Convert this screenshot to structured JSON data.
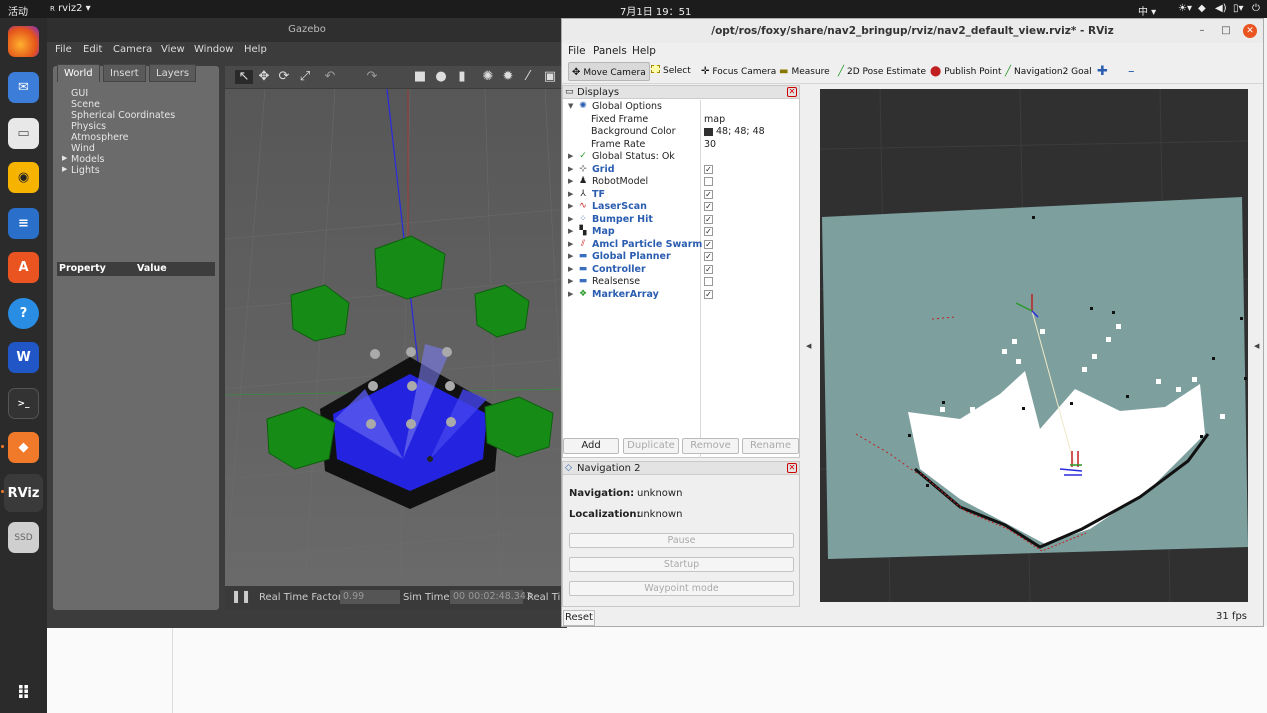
{
  "topbar": {
    "activities": "活动",
    "app": "rviz2",
    "clock": "7月1日  19：51",
    "ime": "中"
  },
  "gazebo": {
    "title": "Gazebo",
    "menu": [
      "File",
      "Edit",
      "Camera",
      "View",
      "Window",
      "Help"
    ],
    "tabs": [
      "World",
      "Insert",
      "Layers"
    ],
    "tree": [
      "GUI",
      "Scene",
      "Spherical Coordinates",
      "Physics",
      "Atmosphere",
      "Wind",
      "Models",
      "Lights"
    ],
    "prop_header": [
      "Property",
      "Value"
    ],
    "status": {
      "rtf_label": "Real Time Factor:",
      "rtf_value": "0.99",
      "sim_label": "Sim Time:",
      "sim_value": "00 00:02:48.343",
      "real_label": "Real Ti"
    }
  },
  "rviz": {
    "title": "/opt/ros/foxy/share/nav2_bringup/rviz/nav2_default_view.rviz* - RViz",
    "menu": [
      "File",
      "Panels",
      "Help"
    ],
    "tools": [
      "Move Camera",
      "Select",
      "Focus Camera",
      "Measure",
      "2D Pose Estimate",
      "Publish Point",
      "Navigation2 Goal"
    ],
    "displays_title": "Displays",
    "global_options": "Global Options",
    "options": [
      {
        "name": "Fixed Frame",
        "value": "map"
      },
      {
        "name": "Background Color",
        "value": "48; 48; 48"
      },
      {
        "name": "Frame Rate",
        "value": "30"
      }
    ],
    "global_status": "Global Status: Ok",
    "displays": [
      {
        "name": "Grid",
        "checked": "✓"
      },
      {
        "name": "RobotModel",
        "checked": ""
      },
      {
        "name": "TF",
        "checked": "✓"
      },
      {
        "name": "LaserScan",
        "checked": "✓"
      },
      {
        "name": "Bumper Hit",
        "checked": "✓"
      },
      {
        "name": "Map",
        "checked": "✓"
      },
      {
        "name": "Amcl Particle Swarm",
        "checked": "✓"
      },
      {
        "name": "Global Planner",
        "checked": "✓"
      },
      {
        "name": "Controller",
        "checked": "✓"
      },
      {
        "name": "Realsense",
        "checked": ""
      },
      {
        "name": "MarkerArray",
        "checked": "✓"
      }
    ],
    "buttons": [
      "Add",
      "Duplicate",
      "Remove",
      "Rename"
    ],
    "nav_title": "Navigation 2",
    "navigation_label": "Navigation:",
    "navigation_value": "unknown",
    "localization_label": "Localization:",
    "localization_value": "unknown",
    "nav_buttons": [
      "Pause",
      "Startup",
      "Waypoint mode"
    ],
    "reset": "Reset",
    "fps": "31 fps",
    "bg_color": "#303030"
  },
  "dock": {
    "ssd_label": "SSD",
    "rviz_label": "RViz"
  }
}
